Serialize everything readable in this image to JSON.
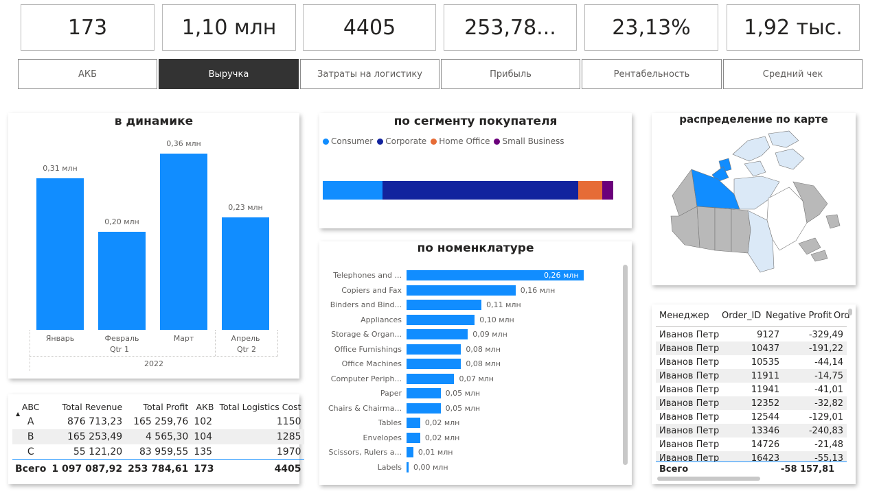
{
  "kpis": [
    {
      "value": "173"
    },
    {
      "value": "1,10 млн"
    },
    {
      "value": "4405"
    },
    {
      "value": "253,78..."
    },
    {
      "value": "23,13%"
    },
    {
      "value": "1,92 тыс."
    }
  ],
  "tabs": [
    {
      "label": "АКБ",
      "active": false
    },
    {
      "label": "Выручка",
      "active": true
    },
    {
      "label": "Затраты на логистику",
      "active": false
    },
    {
      "label": "Прибыль",
      "active": false
    },
    {
      "label": "Рентабельность",
      "active": false
    },
    {
      "label": "Средний чек",
      "active": false
    }
  ],
  "dynamics": {
    "title": "в динамике",
    "year_label": "2022",
    "quarters": [
      "Qtr 1",
      "Qtr 2"
    ]
  },
  "segment": {
    "title": "по сегменту покупателя"
  },
  "nomenclature": {
    "title": "по номенклатуре"
  },
  "map": {
    "title": "распределение по карте"
  },
  "chart_data": [
    {
      "type": "bar",
      "title": "в динамике",
      "categories": [
        "Январь",
        "Февраль",
        "Март",
        "Апрель"
      ],
      "values": [
        0.31,
        0.2,
        0.36,
        0.23
      ],
      "data_labels": [
        "0,31 млн",
        "0,20 млн",
        "0,36 млн",
        "0,23 млн"
      ],
      "ylim": [
        0,
        0.36
      ],
      "grid": false,
      "color": "#118dff"
    },
    {
      "type": "bar",
      "orientation": "horizontal",
      "stacked": true,
      "title": "по сегменту покупателя",
      "legend_position": "top-left",
      "series": [
        {
          "name": "Consumer",
          "value": 0.205,
          "color": "#118dff"
        },
        {
          "name": "Corporate",
          "value": 0.675,
          "color": "#12239e"
        },
        {
          "name": "Home Office",
          "value": 0.083,
          "color": "#e66c37"
        },
        {
          "name": "Small Business",
          "value": 0.037,
          "color": "#6b007b"
        }
      ]
    },
    {
      "type": "bar",
      "orientation": "horizontal",
      "title": "по номенклатуре",
      "categories": [
        "Telephones and ...",
        "Copiers and Fax",
        "Binders and Bind...",
        "Appliances",
        "Storage & Organ...",
        "Office Furnishings",
        "Office Machines",
        "Computer Periph...",
        "Paper",
        "Chairs & Chairma...",
        "Tables",
        "Envelopes",
        "Scissors, Rulers a...",
        "Labels"
      ],
      "values": [
        0.26,
        0.16,
        0.11,
        0.1,
        0.09,
        0.08,
        0.08,
        0.07,
        0.05,
        0.05,
        0.02,
        0.02,
        0.01,
        0.0
      ],
      "data_labels": [
        "0,26 млн",
        "0,16 млн",
        "0,11 млн",
        "0,10 млн",
        "0,09 млн",
        "0,08 млн",
        "0,08 млн",
        "0,07 млн",
        "0,05 млн",
        "0,05 млн",
        "0,02 млн",
        "0,02 млн",
        "0,01 млн",
        "0,00 млн"
      ],
      "xlim": [
        0,
        0.26
      ],
      "color": "#118dff"
    }
  ],
  "abc_table": {
    "headers": [
      "ABC",
      "Total Revenue",
      "Total Profit",
      "АКВ",
      "Total Logistics Cost"
    ],
    "rows": [
      [
        "A",
        "876 713,23",
        "165 259,76",
        "102",
        "1150"
      ],
      [
        "B",
        "165 253,49",
        "4 565,30",
        "104",
        "1285"
      ],
      [
        "C",
        "55 121,20",
        "83 959,55",
        "135",
        "1970"
      ]
    ],
    "total": [
      "Всего",
      "1 097 087,92",
      "253 784,61",
      "173",
      "4405"
    ]
  },
  "neg_table": {
    "headers": [
      "Менеджер",
      "Order_ID",
      "Negative Profit",
      "Ord"
    ],
    "rows": [
      [
        "Иванов Петр",
        "9127",
        "-329,49"
      ],
      [
        "Иванов Петр",
        "10437",
        "-191,22"
      ],
      [
        "Иванов Петр",
        "10535",
        "-44,14"
      ],
      [
        "Иванов Петр",
        "11911",
        "-14,75"
      ],
      [
        "Иванов Петр",
        "11941",
        "-41,01"
      ],
      [
        "Иванов Петр",
        "12352",
        "-32,82"
      ],
      [
        "Иванов Петр",
        "12544",
        "-129,01"
      ],
      [
        "Иванов Петр",
        "13346",
        "-240,83"
      ],
      [
        "Иванов Петр",
        "14726",
        "-21,48"
      ],
      [
        "Иванов Петр",
        "16423",
        "-55,13"
      ]
    ],
    "total": [
      "Всего",
      "",
      "-58 157,81"
    ]
  }
}
